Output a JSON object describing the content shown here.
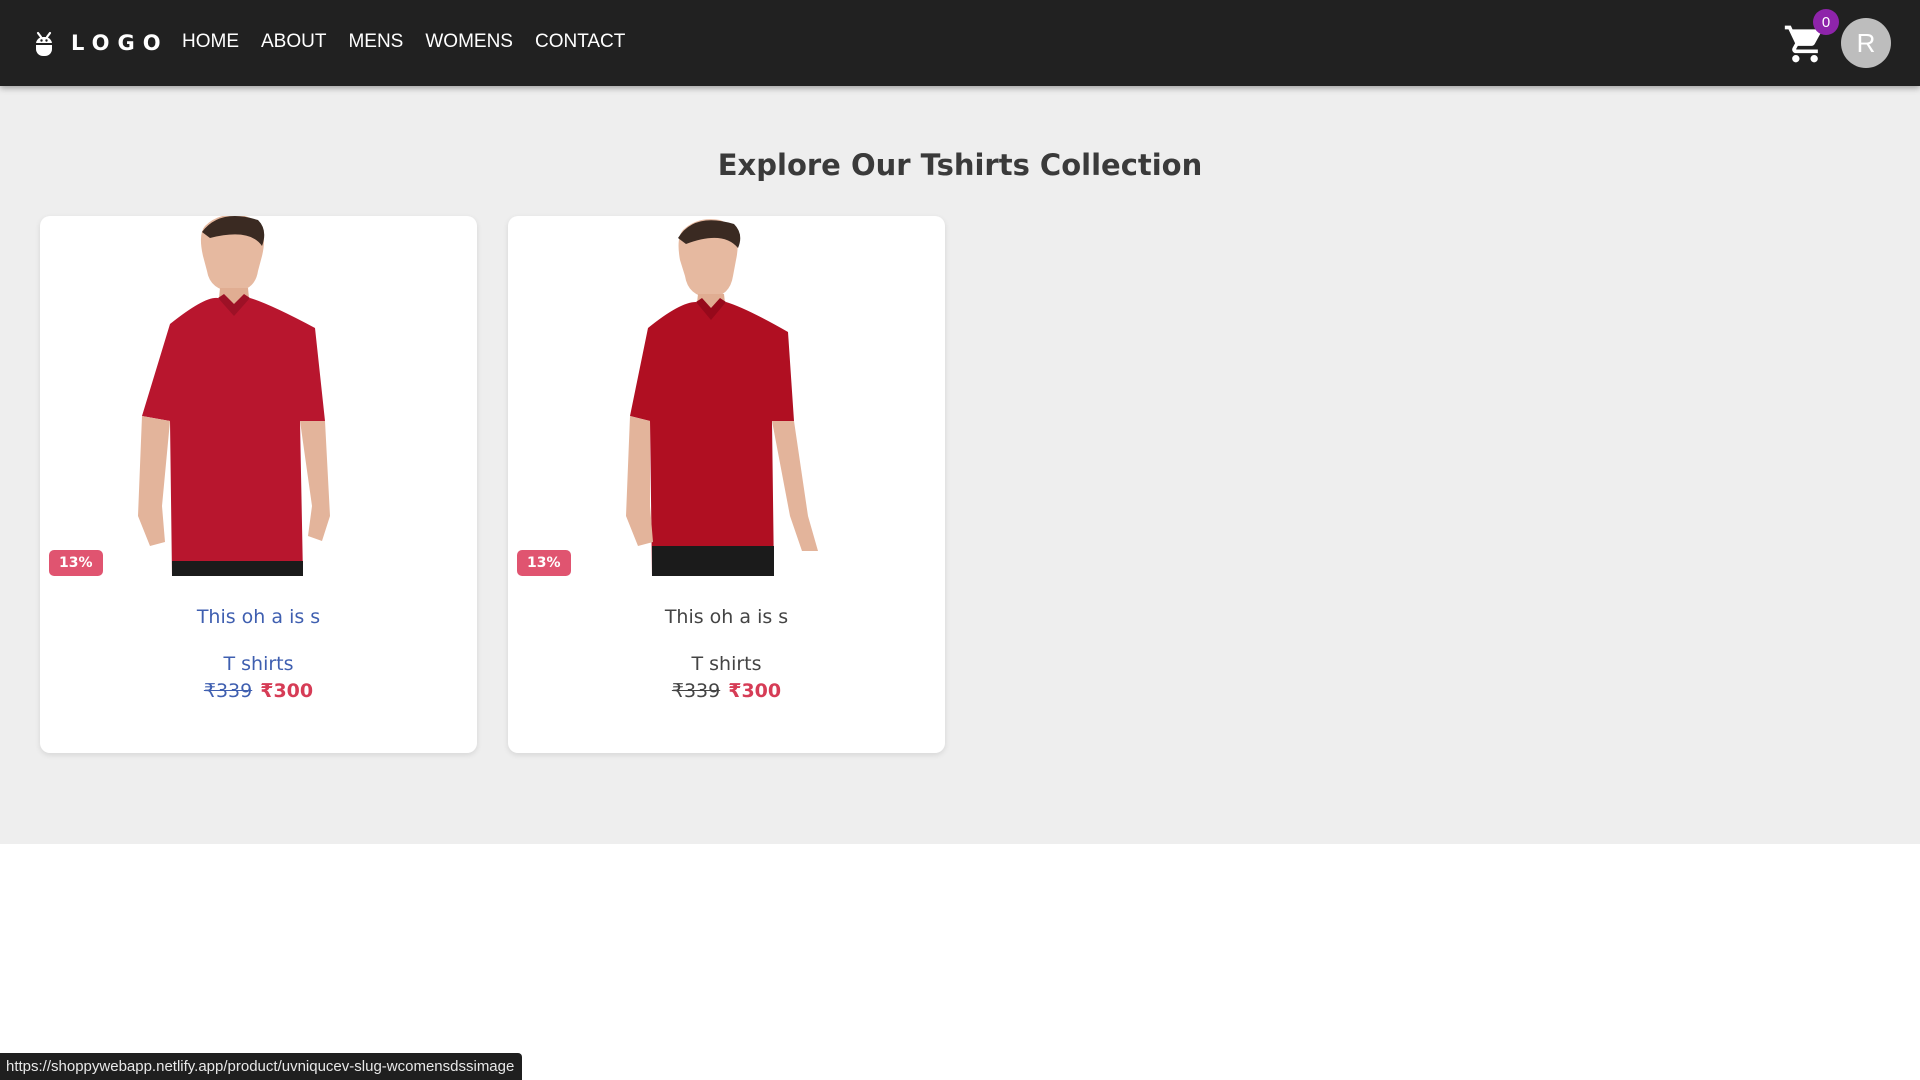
{
  "navbar": {
    "brand": {
      "logo_icon": "bug-mascot-icon",
      "text": "LOGO"
    },
    "links": [
      "HOME",
      "ABOUT",
      "MENS",
      "WOMENS",
      "CONTACT"
    ],
    "cart": {
      "icon": "cart-icon",
      "count": "0"
    },
    "avatar_initial": "R"
  },
  "main": {
    "heading": "Explore Our Tshirts Collection",
    "products": [
      {
        "image": "red-polo-model-photo",
        "discount": "13%",
        "title": "This oh a is s",
        "category": "T shirts",
        "old_price": "₹339",
        "price": "₹300",
        "hovered": true
      },
      {
        "image": "red-polo-model-photo",
        "discount": "13%",
        "title": "This oh a is s",
        "category": "T shirts",
        "old_price": "₹339",
        "price": "₹300",
        "hovered": false
      }
    ]
  },
  "status_bar": {
    "url": "https://shoppywebapp.netlify.app/product/uvniqucev-slug-wcomensdssimage"
  },
  "colors": {
    "navbar": "#212121",
    "background": "#eeeeee",
    "badge": "#8e24aa",
    "discount": "#e05470",
    "price": "#d63c56",
    "hover_text": "#3f5fb0"
  }
}
